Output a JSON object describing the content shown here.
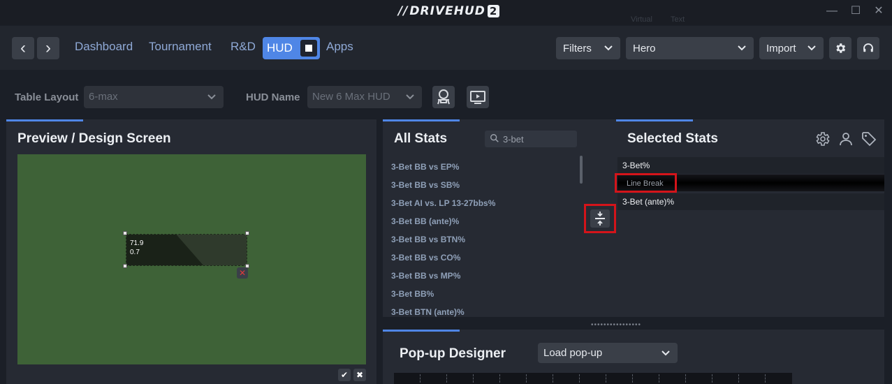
{
  "app": {
    "logo_text": "DRIVEHUD",
    "logo_version": "2",
    "ghost_tabs": [
      "Virtual",
      "Text"
    ]
  },
  "window_controls": {
    "minimize": "—",
    "maximize": "☐",
    "close": "✕"
  },
  "nav": {
    "back": "‹",
    "forward": "›",
    "links": [
      "Dashboard",
      "Tournament",
      "R&D",
      "HUD",
      "Apps"
    ],
    "active": "HUD"
  },
  "header_right": {
    "filters_label": "Filters",
    "player_value": "Hero",
    "import_label": "Import"
  },
  "toolbar": {
    "table_layout_label": "Table Layout",
    "table_layout_value": "6-max",
    "hud_name_label": "HUD Name",
    "hud_name_value": "New 6 Max HUD"
  },
  "preview": {
    "title": "Preview / Design Screen",
    "hud_values": [
      "71.9",
      "0.7"
    ]
  },
  "all_stats": {
    "title": "All Stats",
    "search_value": "3-bet",
    "items": [
      "3-Bet BB vs EP%",
      "3-Bet BB vs SB%",
      "3-Bet AI vs. LP 13-27bbs%",
      "3-Bet BB (ante)%",
      "3-Bet BB vs BTN%",
      "3-Bet BB vs CO%",
      "3-Bet BB vs MP%",
      "3-Bet BB%",
      "3-Bet BTN (ante)%"
    ]
  },
  "selected_stats": {
    "title": "Selected Stats",
    "items": [
      "3-Bet%",
      "Line Break",
      "3-Bet (ante)%"
    ]
  },
  "popup": {
    "title": "Pop-up Designer",
    "load_label": "Load pop-up"
  },
  "colors": {
    "accent": "#4f86e6",
    "highlight": "#d4141a",
    "table_felt": "#3e6237"
  }
}
